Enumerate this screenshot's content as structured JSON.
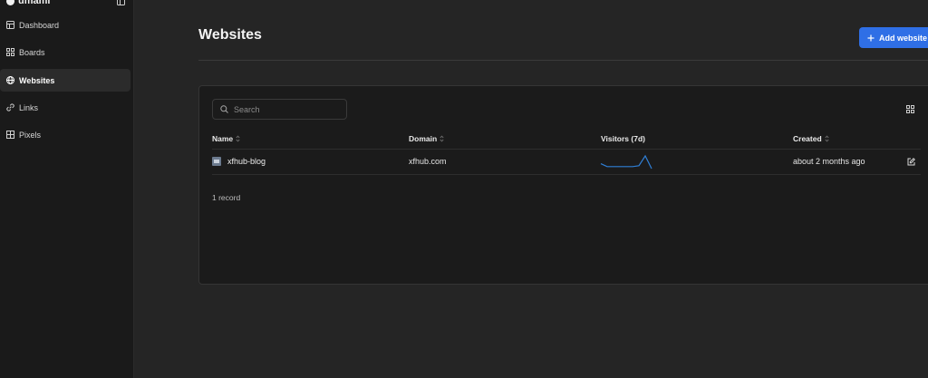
{
  "sidebar": {
    "brand": "umami",
    "items": [
      {
        "label": "Dashboard",
        "icon": "dashboard-icon"
      },
      {
        "label": "Boards",
        "icon": "boards-icon"
      },
      {
        "label": "Websites",
        "icon": "globe-icon",
        "active": true
      },
      {
        "label": "Links",
        "icon": "link-icon"
      },
      {
        "label": "Pixels",
        "icon": "pixels-icon"
      }
    ]
  },
  "header": {
    "title": "Websites",
    "add_button": "Add website"
  },
  "table": {
    "search_placeholder": "Search",
    "columns": [
      "Name",
      "Domain",
      "Visitors (7d)",
      "Created"
    ],
    "rows": [
      {
        "name": "xfhub-blog",
        "domain": "xfhub.com",
        "visitors_sparkline": [
          6,
          3,
          3,
          3,
          3,
          3,
          4,
          14,
          1
        ],
        "created": "about 2 months ago"
      }
    ],
    "record_count": "1 record"
  },
  "colors": {
    "accent": "#2f6fe6",
    "sparkline": "#2f7fd6"
  }
}
